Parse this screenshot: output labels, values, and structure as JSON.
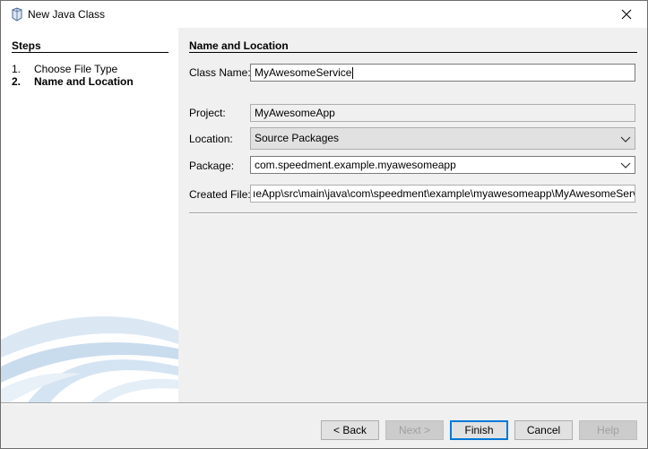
{
  "window": {
    "title": "New Java Class"
  },
  "steps": {
    "title": "Steps",
    "items": [
      {
        "num": "1.",
        "label": "Choose File Type"
      },
      {
        "num": "2.",
        "label": "Name and Location"
      }
    ]
  },
  "form": {
    "section_title": "Name and Location",
    "class_name": {
      "label": "Class Name:",
      "value": "MyAwesomeService"
    },
    "project": {
      "label": "Project:",
      "value": "MyAwesomeApp"
    },
    "location": {
      "label": "Location:",
      "value": "Source Packages"
    },
    "package": {
      "label": "Package:",
      "value": "com.speedment.example.myawesomeapp"
    },
    "created_file": {
      "label": "Created File:",
      "value": "ıeApp\\src\\main\\java\\com\\speedment\\example\\myawesomeapp\\MyAwesomeService.java"
    }
  },
  "buttons": {
    "back": "< Back",
    "next": "Next >",
    "finish": "Finish",
    "cancel": "Cancel",
    "help": "Help"
  },
  "icons": {
    "title": "java-cup-icon",
    "close": "close-icon",
    "dropdown": "chevron-down-icon"
  },
  "colors": {
    "accent": "#0078d7",
    "panel_bg": "#f0f0f0",
    "swoosh": "#c7dcef"
  }
}
